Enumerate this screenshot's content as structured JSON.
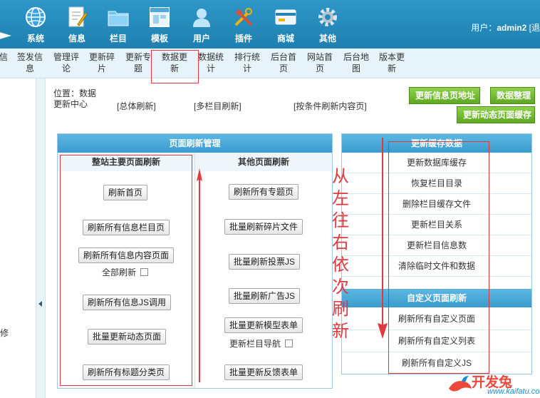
{
  "topnav": [
    {
      "label": "系统",
      "icon": "globe-icon"
    },
    {
      "label": "信息",
      "icon": "document-pen-icon"
    },
    {
      "label": "栏目",
      "icon": "folder-icon"
    },
    {
      "label": "模板",
      "icon": "window-icon"
    },
    {
      "label": "用户",
      "icon": "user-icon"
    },
    {
      "label": "插件",
      "icon": "tools-icon"
    },
    {
      "label": "商城",
      "icon": "card-icon"
    },
    {
      "label": "其他",
      "icon": "gear-icon"
    }
  ],
  "user": {
    "prefix": "用户：",
    "name": "admin2",
    "suffix": " [退"
  },
  "subnav": [
    {
      "label": "信"
    },
    {
      "label": "签发信\n息"
    },
    {
      "label": "管理评\n论"
    },
    {
      "label": "更新碎\n片"
    },
    {
      "label": "更新专\n题"
    },
    {
      "label": "数据更\n新"
    },
    {
      "label": "数据统\n计"
    },
    {
      "label": "排行统\n计"
    },
    {
      "label": "后台首\n页"
    },
    {
      "label": "网站首\n页"
    },
    {
      "label": "后台地\n图"
    },
    {
      "label": "版本更\n新"
    }
  ],
  "left_text": "修",
  "location": {
    "text": "位置：数据更新中心"
  },
  "top_links": [
    "[总体刷新]",
    "[多栏目刷新]",
    "[按条件刷新内容页]"
  ],
  "green_buttons": {
    "update_info_url": "更新信息页地址",
    "data_organize": "数据整理",
    "update_dynamic_cache": "更新动态页面缓存"
  },
  "main_panel": {
    "title": "页面刷新管理",
    "col_left_title": "整站主要页面刷新",
    "col_right_title": "其他页面刷新",
    "left_buttons": [
      "刷新首页",
      "刷新所有信息栏目页",
      "刷新所有信息内容页面",
      "刷新所有信息JS调用",
      "批量更新动态页面",
      "刷新所有标题分类页"
    ],
    "all_refresh_label": "全部刷新",
    "right_buttons": [
      "刷新所有专题页",
      "批量刷新碎片文件",
      "批量刷新投票JS",
      "批量刷新广告JS",
      "批量更新模型表单",
      "批量更新反馈表单"
    ],
    "update_nav_label": "更新栏目导航"
  },
  "right_panel": {
    "cache_title": "更新缓存数据",
    "cache_items": [
      "更新数据库缓存",
      "恢复栏目目录",
      "删除栏目缓存文件",
      "更新栏目关系",
      "更新栏目信息数",
      "清除临时文件和数据"
    ],
    "custom_title": "自定义页面刷新",
    "custom_items": [
      "刷新所有自定义页面",
      "刷新所有自定义列表",
      "刷新所有自定义JS"
    ]
  },
  "annotation": {
    "text": "从左往右依次刷新",
    "color": "#e0393e"
  },
  "watermark": {
    "cn": "开发兔",
    "en": "www.kaifatu.com"
  }
}
